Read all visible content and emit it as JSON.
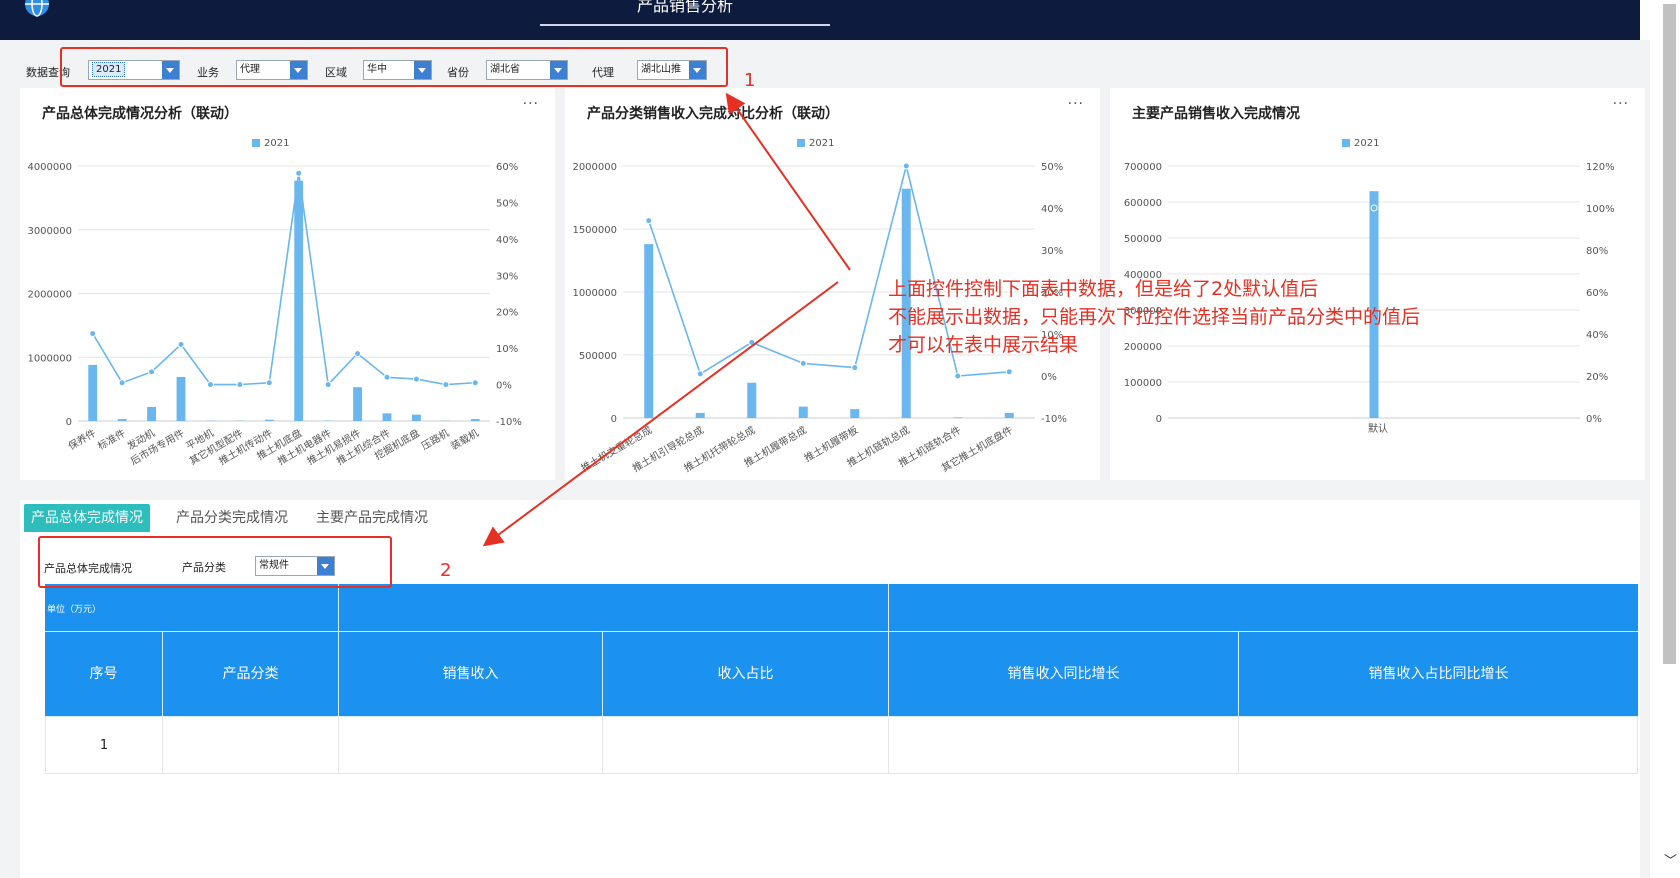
{
  "header": {
    "title": "产品销售分析"
  },
  "filters": {
    "query_label": "数据查询",
    "year": "2021",
    "business_label": "业务",
    "business": "代理",
    "region_label": "区域",
    "region": "华中",
    "province_label": "省份",
    "province": "湖北省",
    "agent_label": "代理",
    "agent": "湖北山推"
  },
  "markers": {
    "one": "1",
    "two": "2"
  },
  "panels": [
    {
      "title": "产品总体完成情况分析（联动）",
      "menu": "···"
    },
    {
      "title": "产品分类销售收入完成对比分析（联动）",
      "menu": "···"
    },
    {
      "title": "主要产品销售收入完成情况",
      "menu": "···"
    }
  ],
  "chart_data": [
    {
      "type": "bar",
      "legend": [
        "2021"
      ],
      "categories": [
        "保养件",
        "标准件",
        "发动机",
        "后市场专用件",
        "平地机",
        "其它机型配件",
        "推土机传动件",
        "推土机底盘",
        "推土机电器件",
        "推土机易损件",
        "推土机综合件",
        "挖掘机底盘",
        "压路机",
        "装载机"
      ],
      "series": [
        {
          "name": "2021",
          "type": "bar",
          "axis": "left",
          "values": [
            880000,
            30000,
            220000,
            690000,
            5000,
            5000,
            20000,
            3770000,
            5000,
            530000,
            120000,
            100000,
            5000,
            30000
          ]
        },
        {
          "type": "line",
          "axis": "right",
          "values": [
            14,
            0.5,
            3.5,
            11,
            0,
            0,
            0.5,
            58,
            0,
            8.5,
            2,
            1.5,
            0,
            0.5
          ]
        }
      ],
      "ylim": [
        0,
        4000000
      ],
      "yticks": [
        "0",
        "1000000",
        "2000000",
        "3000000",
        "4000000"
      ],
      "y2lim": [
        -10,
        60
      ],
      "y2ticks": [
        "-10%",
        "0%",
        "10%",
        "20%",
        "30%",
        "40%",
        "50%",
        "60%"
      ],
      "legend_position": "top-center"
    },
    {
      "type": "bar",
      "legend": [
        "2021"
      ],
      "categories": [
        "推土机支重轮总成",
        "推土机引导轮总成",
        "推土机托带轮总成",
        "推土机履带总成",
        "推土机履带板",
        "推土机链轨总成",
        "推土机链轨合件",
        "其它推土机底盘件"
      ],
      "series": [
        {
          "name": "2021",
          "type": "bar",
          "axis": "left",
          "values": [
            1380000,
            40000,
            280000,
            90000,
            70000,
            1820000,
            5000,
            40000
          ]
        },
        {
          "type": "line",
          "axis": "right",
          "values": [
            37,
            0.5,
            8,
            3,
            2,
            50,
            0,
            1
          ]
        }
      ],
      "ylim": [
        0,
        2000000
      ],
      "yticks": [
        "0",
        "500000",
        "1000000",
        "1500000",
        "2000000"
      ],
      "y2lim": [
        -10,
        50
      ],
      "y2ticks": [
        "-10%",
        "0%",
        "10%",
        "20%",
        "30%",
        "40%",
        "50%"
      ],
      "legend_position": "top-center"
    },
    {
      "type": "bar",
      "legend": [
        "2021"
      ],
      "categories": [
        "默认"
      ],
      "series": [
        {
          "name": "2021",
          "type": "bar",
          "axis": "left",
          "values": [
            630000
          ]
        },
        {
          "type": "line",
          "axis": "right",
          "values": [
            100
          ]
        }
      ],
      "ylim": [
        0,
        700000
      ],
      "yticks": [
        "0",
        "100000",
        "200000",
        "300000",
        "400000",
        "500000",
        "600000",
        "700000"
      ],
      "y2lim": [
        0,
        120
      ],
      "y2ticks": [
        "0%",
        "20%",
        "40%",
        "60%",
        "80%",
        "100%",
        "120%"
      ],
      "legend_position": "top-center"
    }
  ],
  "colors": {
    "bar": "#6ab6ee",
    "line": "#6ab6ee",
    "grid": "#e4e4e4",
    "header": "#0d1b3f",
    "table_header": "#1b91f0",
    "tab_active": "#2ebdbd",
    "annotation": "#e53023"
  },
  "tabs": [
    "产品总体完成情况",
    "产品分类完成情况",
    "主要产品完成情况"
  ],
  "table_filter": {
    "title": "产品总体完成情况",
    "category_label": "产品分类",
    "category_value": "常规件"
  },
  "table": {
    "unit": "单位（万元）",
    "columns": [
      "序号",
      "产品分类",
      "销售收入",
      "收入占比",
      "销售收入同比增长",
      "销售收入占比同比增长"
    ],
    "rows": [
      {
        "index": "1"
      }
    ]
  },
  "annotation": {
    "line1": "上面控件控制下面表中数据，但是给了2处默认值后",
    "line2": "不能展示出数据，只能再次下拉控件选择当前产品分类中的值后",
    "line3": "才可以在表中展示结果"
  }
}
